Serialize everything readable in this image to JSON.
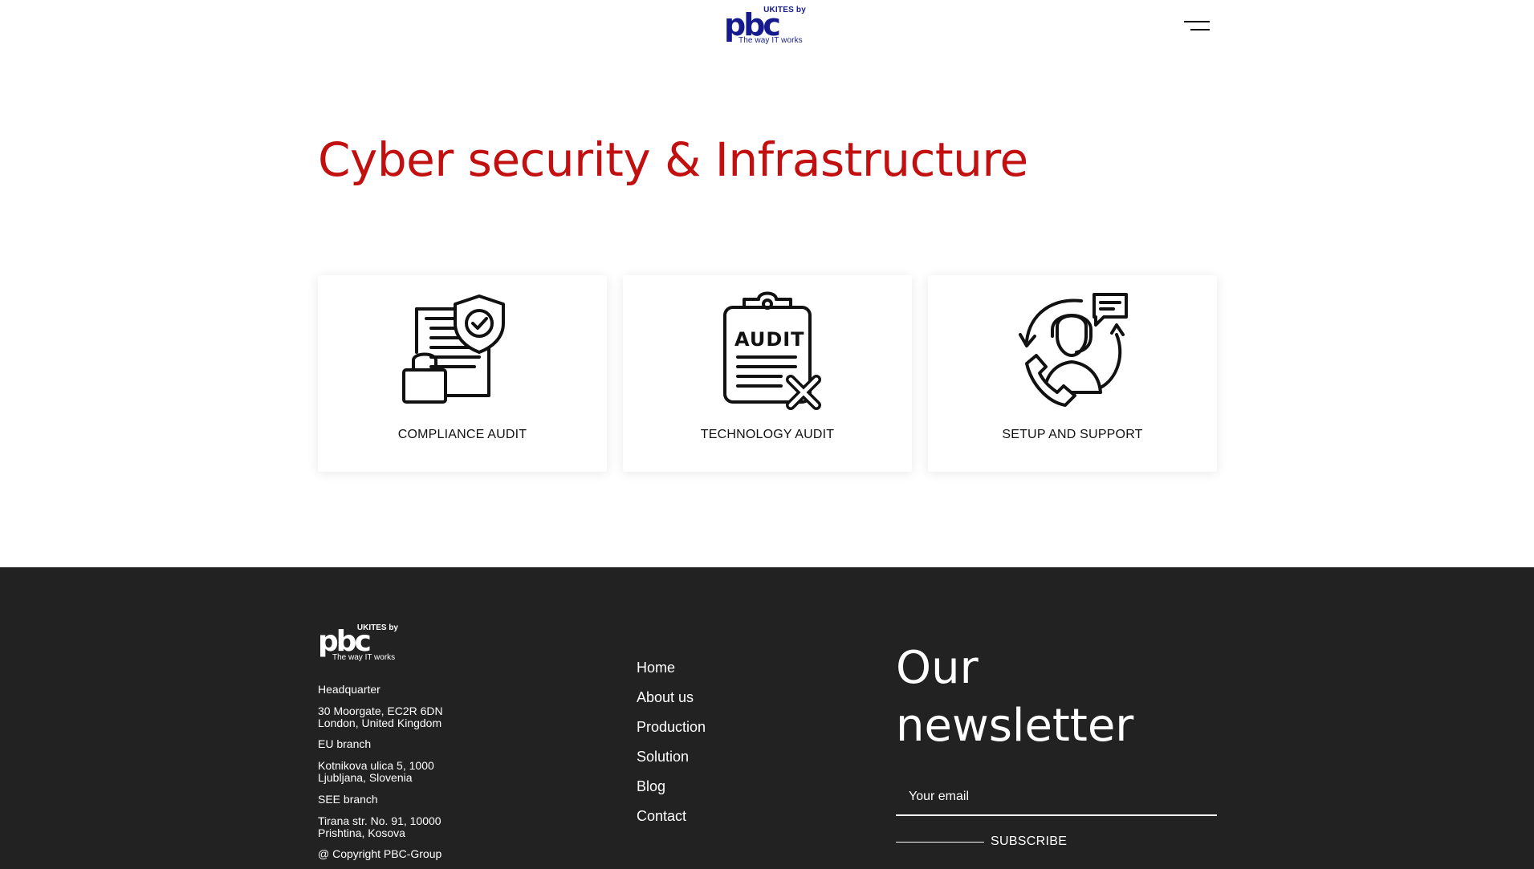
{
  "header": {
    "logo": {
      "top": "UKITES by",
      "main": "pbc",
      "tagline": "The way IT works"
    },
    "menu_icon": "hamburger-menu-icon"
  },
  "main": {
    "title": "Cyber security & Infrastructure",
    "cards": [
      {
        "label": "COMPLIANCE AUDIT",
        "icon": "compliance-document-shield-lock-icon"
      },
      {
        "label": "TECHNOLOGY AUDIT",
        "icon": "audit-clipboard-icon"
      },
      {
        "label": "SETUP AND SUPPORT",
        "icon": "support-agent-headset-icon"
      }
    ]
  },
  "footer": {
    "logo": {
      "top": "UKITES by",
      "main": "pbc",
      "tagline": "The way IT works"
    },
    "hq_label": "Headquarter",
    "hq_address_1": "30 Moorgate, EC2R 6DN",
    "hq_address_2": "London, United Kingdom",
    "eu_label": "EU branch",
    "eu_address_1": "Kotnikova ulica 5, 1000",
    "eu_address_2": "Ljubljana, Slovenia",
    "see_label": "SEE branch",
    "see_address_1": "Tirana str. No. 91, 10000",
    "see_address_2": "Prishtina, Kosova",
    "copyright": "@ Copyright PBC-Group",
    "nav": [
      "Home",
      "About us",
      "Production",
      "Solution",
      "Blog",
      "Contact"
    ],
    "newsletter_title_1": "Our",
    "newsletter_title_2": "newsletter",
    "email_placeholder": "Your email",
    "subscribe_label": "SUBSCRIBE"
  },
  "colors": {
    "title_red": "#c20f0f",
    "logo_blue": "#151b8d",
    "footer_bg": "#222222"
  }
}
